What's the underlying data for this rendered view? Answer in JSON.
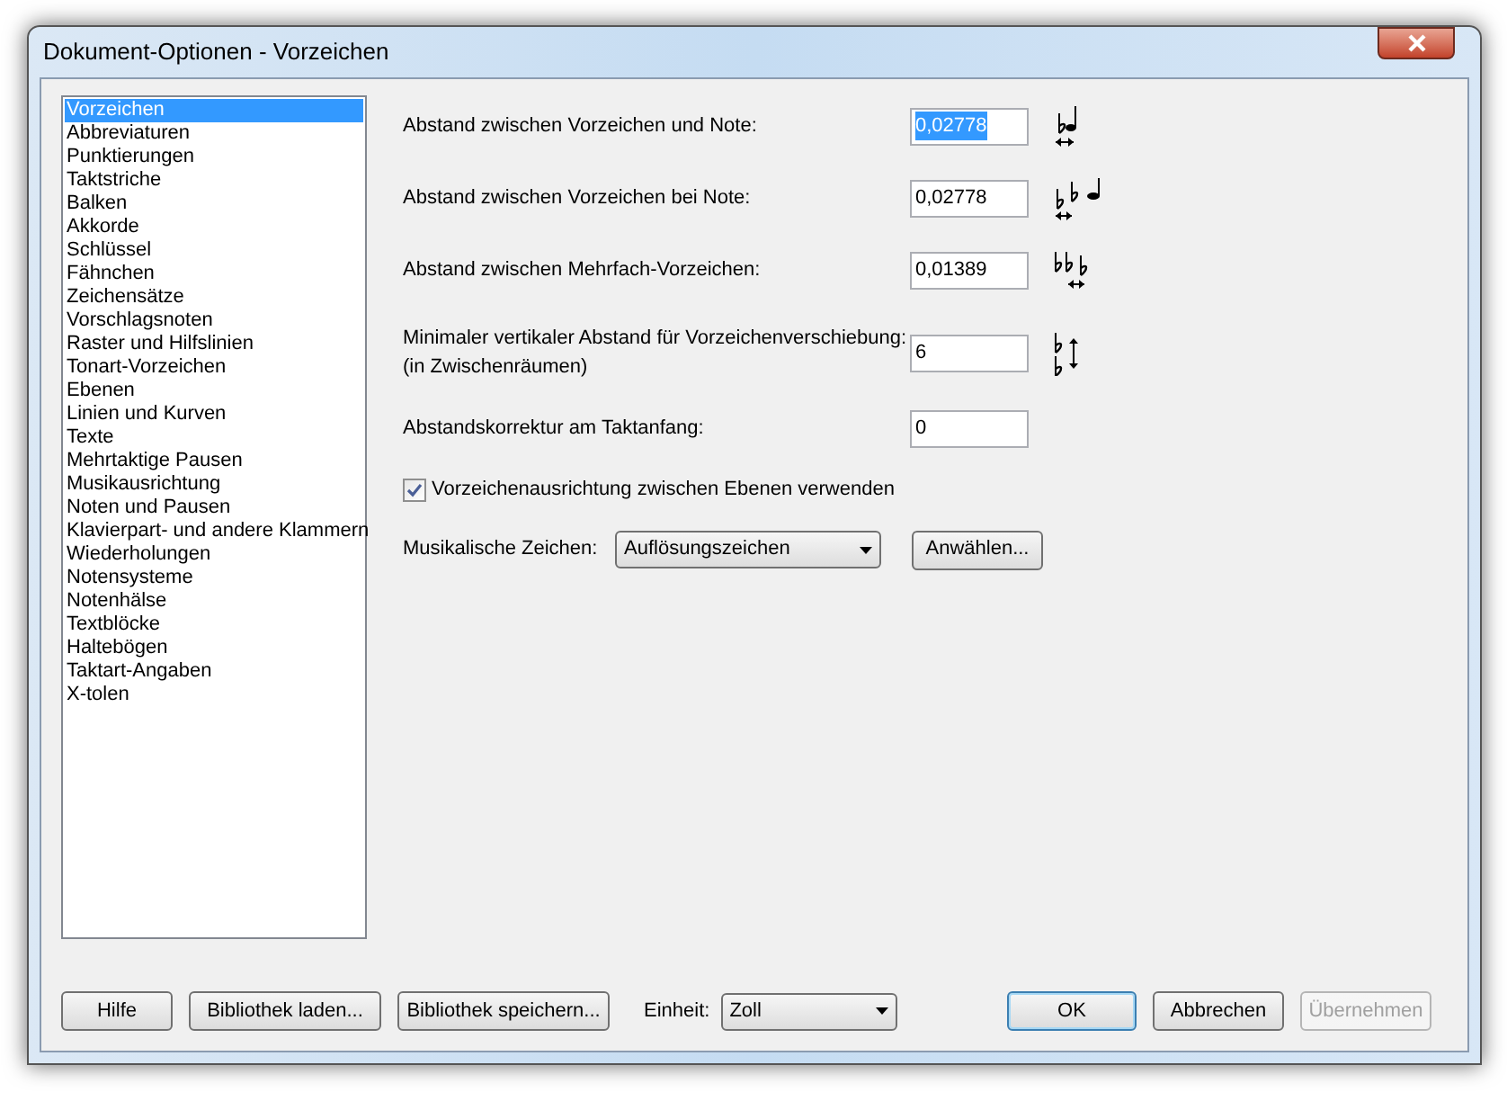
{
  "window": {
    "title": "Dokument-Optionen - Vorzeichen"
  },
  "sidebar": {
    "items": [
      {
        "label": "Vorzeichen",
        "selected": true
      },
      {
        "label": "Abbreviaturen",
        "selected": false
      },
      {
        "label": "Punktierungen",
        "selected": false
      },
      {
        "label": "Taktstriche",
        "selected": false
      },
      {
        "label": "Balken",
        "selected": false
      },
      {
        "label": "Akkorde",
        "selected": false
      },
      {
        "label": "Schlüssel",
        "selected": false
      },
      {
        "label": "Fähnchen",
        "selected": false
      },
      {
        "label": "Zeichensätze",
        "selected": false
      },
      {
        "label": "Vorschlagsnoten",
        "selected": false
      },
      {
        "label": "Raster und Hilfslinien",
        "selected": false
      },
      {
        "label": "Tonart-Vorzeichen",
        "selected": false
      },
      {
        "label": "Ebenen",
        "selected": false
      },
      {
        "label": "Linien und Kurven",
        "selected": false
      },
      {
        "label": "Texte",
        "selected": false
      },
      {
        "label": "Mehrtaktige Pausen",
        "selected": false
      },
      {
        "label": "Musikausrichtung",
        "selected": false
      },
      {
        "label": "Noten und Pausen",
        "selected": false
      },
      {
        "label": "Klavierpart- und andere Klammern",
        "selected": false
      },
      {
        "label": "Wiederholungen",
        "selected": false
      },
      {
        "label": "Notensysteme",
        "selected": false
      },
      {
        "label": "Notenhälse",
        "selected": false
      },
      {
        "label": "Textblöcke",
        "selected": false
      },
      {
        "label": "Haltebögen",
        "selected": false
      },
      {
        "label": "Taktart-Angaben",
        "selected": false
      },
      {
        "label": "X-tolen",
        "selected": false
      }
    ]
  },
  "fields": [
    {
      "label": "Abstand zwischen Vorzeichen und Note:",
      "value": "0,02778",
      "text_selected": true
    },
    {
      "label": "Abstand zwischen Vorzeichen bei Note:",
      "value": "0,02778",
      "text_selected": false
    },
    {
      "label": "Abstand zwischen Mehrfach-Vorzeichen:",
      "value": "0,01389",
      "text_selected": false
    },
    {
      "label": "Minimaler vertikaler Abstand für Vorzeichenverschiebung:",
      "sublabel": "(in Zwischenräumen)",
      "value": "6",
      "text_selected": false
    },
    {
      "label": "Abstandskorrektur am Taktanfang:",
      "value": "0",
      "text_selected": false
    }
  ],
  "checkbox": {
    "label": "Vorzeichenausrichtung zwischen Ebenen verwenden",
    "checked": true
  },
  "symbol": {
    "label": "Musikalische Zeichen:",
    "value": "Auflösungszeichen",
    "button": "Anwählen..."
  },
  "footer": {
    "buttons": [
      {
        "label": "Hilfe",
        "disabled": false
      },
      {
        "label": "Bibliothek laden...",
        "disabled": false
      },
      {
        "label": "Bibliothek speichern...",
        "disabled": false
      }
    ],
    "unit": {
      "label": "Einheit:",
      "value": "Zoll"
    },
    "actions": [
      {
        "label": "OK",
        "default": true,
        "disabled": false
      },
      {
        "label": "Abbrechen",
        "default": false,
        "disabled": false
      },
      {
        "label": "Übernehmen",
        "default": false,
        "disabled": true
      }
    ]
  }
}
